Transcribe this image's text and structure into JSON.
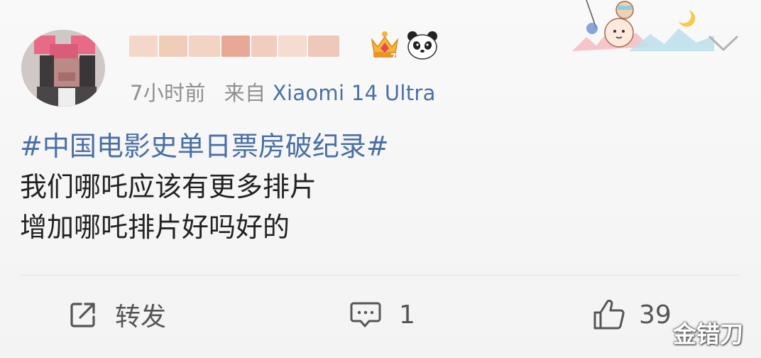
{
  "post": {
    "username": "",
    "meta": {
      "time": "7小时前",
      "source_prefix": "来自",
      "device": "Xiaomi 14 Ultra"
    },
    "content": {
      "hashtag": "#中国电影史单日票房破纪录#",
      "lines": [
        "我们哪吒应该有更多排片",
        "增加哪吒排片好吗好的"
      ]
    },
    "actions": {
      "repost_label": "转发",
      "comment_count": "1",
      "like_count": "39"
    },
    "badges": [
      "crown-badge-icon",
      "panda-emoji-icon"
    ]
  },
  "watermark": "金错刀",
  "colors": {
    "link_blue": "#4a6fa5",
    "text": "#222222",
    "meta_gray": "#8f8f8f",
    "action_gray": "#555555"
  }
}
